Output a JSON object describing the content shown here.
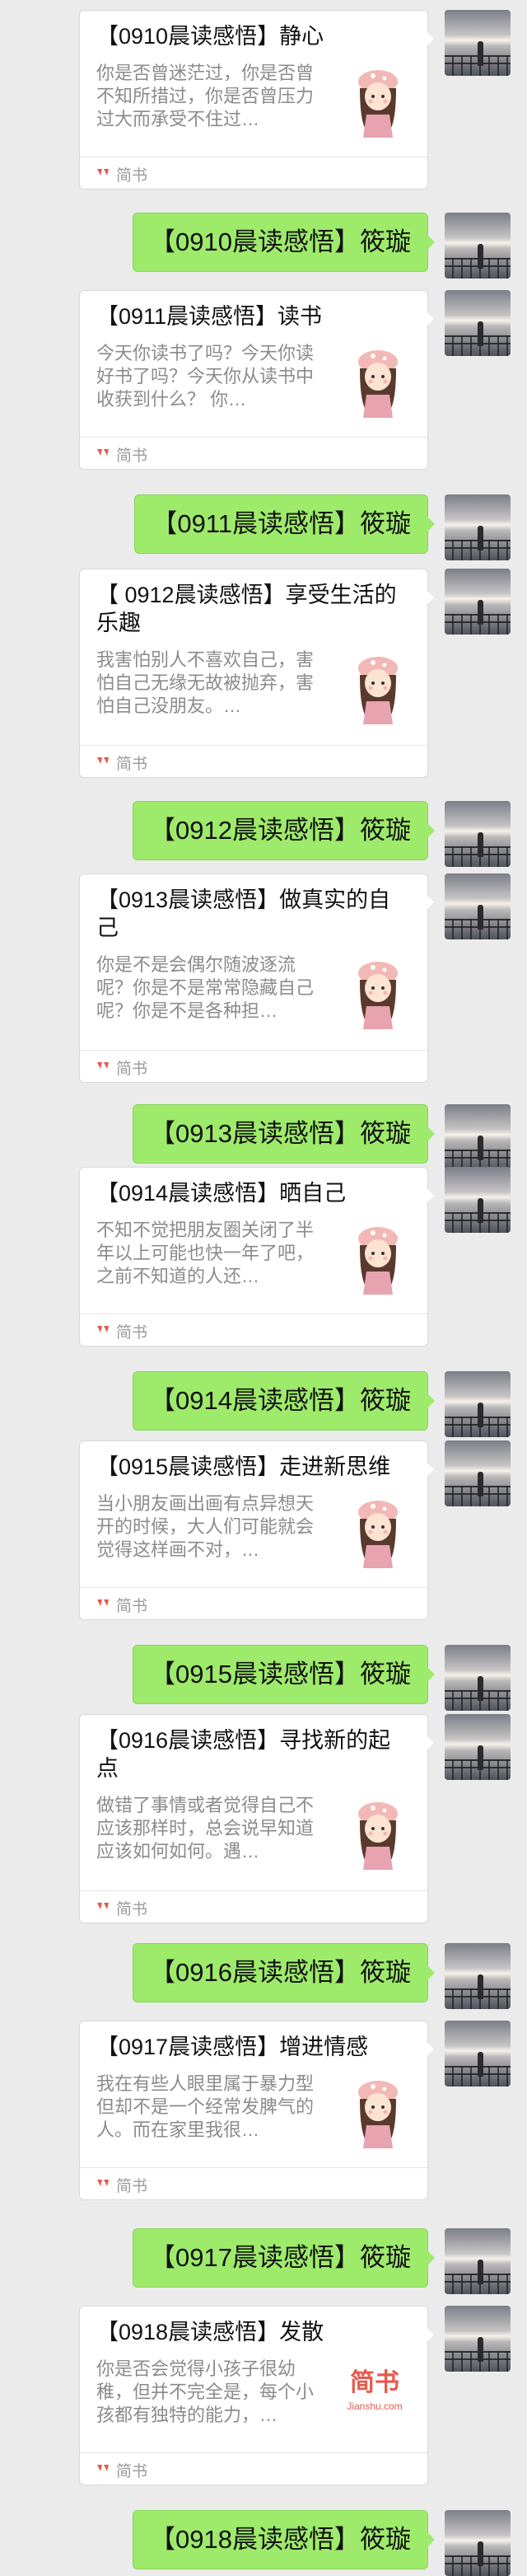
{
  "source_label": "简书",
  "colors": {
    "bubble": "#9eea6a",
    "background": "#ebebeb",
    "logo": "#e55a4e"
  },
  "cards": [
    {
      "title": "【0910晨读感悟】静心",
      "desc": "你是否曾迷茫过，你是否曾不知所措过，你是否曾压力过大而承受不住过…",
      "thumb": "girl"
    },
    {
      "title": "【0911晨读感悟】读书",
      "desc": "今天你读书了吗？今天你读好书了吗？今天你从读书中收获到什么？ 你…",
      "thumb": "girl"
    },
    {
      "title": "【 0912晨读感悟】享受生活的乐趣",
      "desc": "我害怕别人不喜欢自己，害怕自己无缘无故被抛弃，害怕自己没朋友。…",
      "thumb": "girl"
    },
    {
      "title": "【0913晨读感悟】做真实的自己",
      "desc": "你是不是会偶尔随波逐流呢？你是不是常常隐藏自己呢？你是不是各种担…",
      "thumb": "girl"
    },
    {
      "title": "【0914晨读感悟】晒自己",
      "desc": "不知不觉把朋友圈关闭了半年以上可能也快一年了吧，之前不知道的人还…",
      "thumb": "girl"
    },
    {
      "title": "【0915晨读感悟】走进新思维",
      "desc": "当小朋友画出画有点异想天开的时候，大人们可能就会觉得这样画不对，…",
      "thumb": "girl"
    },
    {
      "title": "【0916晨读感悟】寻找新的起点",
      "desc": "做错了事情或者觉得自己不应该那样时，总会说早知道应该如何如何。遇…",
      "thumb": "girl"
    },
    {
      "title": "【0917晨读感悟】增进情感",
      "desc": "我在有些人眼里属于暴力型但却不是一个经常发脾气的人。而在家里我很…",
      "thumb": "girl"
    },
    {
      "title": "【0918晨读感悟】发散",
      "desc": "你是否会觉得小孩子很幼稚，但并不完全是，每个小孩都有独特的能力，…",
      "thumb": "logo",
      "logo_zh": "简书",
      "logo_en": "Jianshu.com"
    }
  ],
  "bubbles": [
    "【0910晨读感悟】筱璇",
    "【0911晨读感悟】筱璇",
    "【0912晨读感悟】筱璇",
    "【0913晨读感悟】筱璇",
    "【0914晨读感悟】筱璇",
    "【0915晨读感悟】筱璇",
    "【0916晨读感悟】筱璇",
    "【0917晨读感悟】筱璇",
    "【0918晨读感悟】筱璇"
  ]
}
